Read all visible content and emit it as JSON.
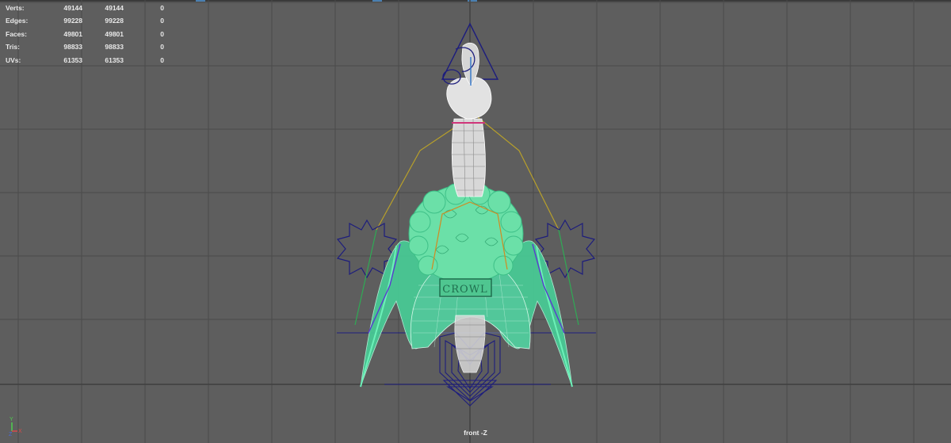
{
  "viewport": {
    "camera": "front -Z",
    "background_color": "#5e5e5e",
    "grid_color": "#4a4a4a",
    "axis_line_color": "#3f3f3f"
  },
  "hud": {
    "rows": [
      {
        "label": "Verts:",
        "v1": "49144",
        "v2": "49144",
        "v3": "0"
      },
      {
        "label": "Edges:",
        "v1": "99228",
        "v2": "99228",
        "v3": "0"
      },
      {
        "label": "Faces:",
        "v1": "49801",
        "v2": "49801",
        "v3": "0"
      },
      {
        "label": "Tris:",
        "v1": "98833",
        "v2": "98833",
        "v3": "0"
      },
      {
        "label": "UVs:",
        "v1": "61353",
        "v2": "61353",
        "v3": "0"
      }
    ]
  },
  "model": {
    "emblem_text": "CROWL",
    "wireframe_color": "#ffffff",
    "selected_color": "#4de8a8",
    "control_color": "#1a1a7a"
  },
  "axis_gizmo": {
    "y_label": "Y",
    "x_label": "X",
    "z_label": "Z",
    "y_color": "#4fcf4f",
    "x_color": "#d84a4a",
    "z_color": "#4a6ad8"
  }
}
